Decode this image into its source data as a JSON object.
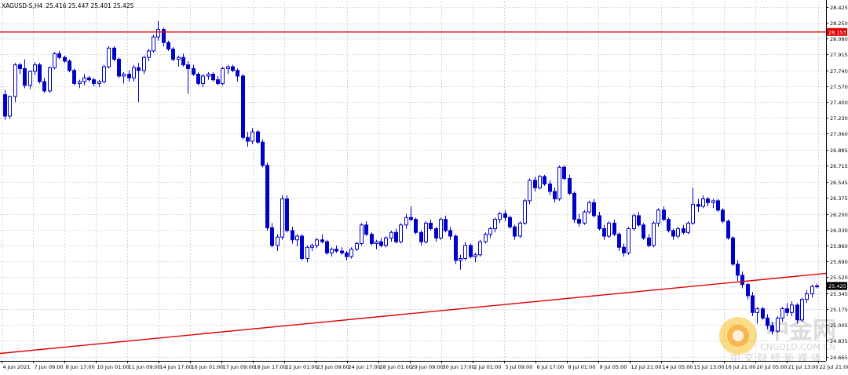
{
  "header": {
    "symbol": "XAGUSD-S,H4",
    "ohlc": "25.416 25.447 25.401 25.425"
  },
  "watermark": {
    "brand": "中金网",
    "url": "CNGOLD.COM.CN",
    "tagline": "中 文 财 经 新 媒 体"
  },
  "colors": {
    "background": "#ffffff",
    "grid": "#b4b4b4",
    "candle": "#0000c8",
    "resistance_line": "#e00000",
    "trend_line": "#e00000",
    "price_tag_red": "#e00000",
    "price_tag_dark": "#000000"
  },
  "chart_data": {
    "type": "candlestick",
    "timeframe": "H4",
    "ylim": [
      24.62,
      28.48
    ],
    "grid": true,
    "y_ticks": [
      "28.425",
      "28.250",
      "28.080",
      "27.915",
      "27.740",
      "27.570",
      "27.400",
      "27.230",
      "27.060",
      "26.885",
      "26.715",
      "26.545",
      "26.375",
      "26.200",
      "26.030",
      "25.860",
      "25.690",
      "25.520",
      "25.345",
      "25.175",
      "25.005",
      "24.835",
      "24.665"
    ],
    "x_ticks": [
      "4 Jun 2021",
      "7 Jun 09:00",
      "8 Jun 17:00",
      "10 Jun 01:00",
      "11 Jun 09:00",
      "14 Jun 17:00",
      "16 Jun 01:00",
      "17 Jun 09:00",
      "18 Jun 17:00",
      "22 Jun 01:00",
      "23 Jun 09:00",
      "24 Jun 17:00",
      "28 Jun 01:00",
      "29 Jun 09:00",
      "30 Jun 17:00",
      "2 Jul 01:00",
      "5 Jul 09:00",
      "6 Jul 17:00",
      "8 Jul 01:00",
      "9 Jul 05:00",
      "12 Jul 21:00",
      "14 Jul 05:00",
      "15 Jul 13:00",
      "16 Jul 21:00",
      "20 Jul 05:00",
      "21 Jul 13:00",
      "22 Jul 21:00"
    ],
    "resistance_level": 28.153,
    "trend_line": {
      "from": 24.7,
      "to": 25.56
    },
    "current_price": 25.425,
    "candles": [
      [
        27.48,
        27.53,
        27.21,
        27.25
      ],
      [
        27.25,
        27.47,
        27.22,
        27.46
      ],
      [
        27.46,
        27.82,
        27.4,
        27.8
      ],
      [
        27.8,
        27.82,
        27.7,
        27.76
      ],
      [
        27.76,
        27.86,
        27.55,
        27.58
      ],
      [
        27.58,
        27.74,
        27.54,
        27.73
      ],
      [
        27.73,
        27.83,
        27.69,
        27.8
      ],
      [
        27.8,
        27.82,
        27.6,
        27.62
      ],
      [
        27.62,
        27.66,
        27.5,
        27.52
      ],
      [
        27.52,
        27.78,
        27.5,
        27.77
      ],
      [
        27.77,
        27.94,
        27.75,
        27.92
      ],
      [
        27.92,
        27.95,
        27.86,
        27.88
      ],
      [
        27.88,
        27.9,
        27.82,
        27.84
      ],
      [
        27.84,
        27.86,
        27.72,
        27.74
      ],
      [
        27.74,
        27.76,
        27.58,
        27.6
      ],
      [
        27.6,
        27.64,
        27.55,
        27.62
      ],
      [
        27.62,
        27.7,
        27.58,
        27.66
      ],
      [
        27.66,
        27.68,
        27.62,
        27.64
      ],
      [
        27.64,
        27.66,
        27.57,
        27.6
      ],
      [
        27.6,
        27.64,
        27.56,
        27.62
      ],
      [
        27.62,
        27.8,
        27.6,
        27.78
      ],
      [
        27.78,
        28.0,
        27.76,
        27.98
      ],
      [
        27.98,
        28.0,
        27.84,
        27.86
      ],
      [
        27.86,
        27.88,
        27.66,
        27.68
      ],
      [
        27.68,
        27.72,
        27.6,
        27.7
      ],
      [
        27.7,
        27.74,
        27.62,
        27.66
      ],
      [
        27.66,
        27.8,
        27.62,
        27.77
      ],
      [
        27.77,
        27.82,
        27.4,
        27.74
      ],
      [
        27.74,
        27.9,
        27.7,
        27.88
      ],
      [
        27.88,
        27.97,
        27.84,
        27.95
      ],
      [
        27.95,
        28.12,
        27.93,
        28.1
      ],
      [
        28.1,
        28.27,
        28.06,
        28.18
      ],
      [
        28.18,
        28.2,
        28.0,
        28.04
      ],
      [
        28.04,
        28.06,
        27.95,
        27.97
      ],
      [
        27.97,
        27.99,
        27.84,
        27.86
      ],
      [
        27.86,
        27.9,
        27.78,
        27.88
      ],
      [
        27.88,
        27.92,
        27.78,
        27.8
      ],
      [
        27.8,
        27.84,
        27.49,
        27.76
      ],
      [
        27.76,
        27.8,
        27.68,
        27.7
      ],
      [
        27.7,
        27.72,
        27.58,
        27.6
      ],
      [
        27.6,
        27.7,
        27.56,
        27.68
      ],
      [
        27.68,
        27.72,
        27.64,
        27.7
      ],
      [
        27.7,
        27.72,
        27.62,
        27.64
      ],
      [
        27.64,
        27.68,
        27.58,
        27.6
      ],
      [
        27.6,
        27.78,
        27.58,
        27.76
      ],
      [
        27.76,
        27.8,
        27.7,
        27.78
      ],
      [
        27.78,
        27.8,
        27.72,
        27.74
      ],
      [
        27.74,
        27.76,
        27.62,
        27.68
      ],
      [
        27.68,
        27.7,
        27.0,
        27.02
      ],
      [
        27.02,
        27.08,
        26.92,
        26.98
      ],
      [
        26.98,
        27.12,
        26.95,
        27.08
      ],
      [
        27.08,
        27.1,
        26.95,
        26.97
      ],
      [
        26.97,
        27.0,
        26.7,
        26.72
      ],
      [
        26.72,
        26.75,
        26.02,
        26.05
      ],
      [
        26.05,
        26.1,
        25.84,
        25.86
      ],
      [
        25.86,
        25.98,
        25.8,
        25.95
      ],
      [
        25.95,
        26.4,
        25.92,
        26.36
      ],
      [
        26.36,
        26.4,
        26.0,
        26.02
      ],
      [
        26.02,
        26.06,
        25.88,
        25.92
      ],
      [
        25.92,
        25.98,
        25.85,
        25.96
      ],
      [
        25.96,
        25.98,
        25.7,
        25.72
      ],
      [
        25.72,
        25.86,
        25.68,
        25.84
      ],
      [
        25.84,
        25.88,
        25.8,
        25.86
      ],
      [
        25.86,
        25.94,
        25.83,
        25.92
      ],
      [
        25.92,
        25.98,
        25.88,
        25.9
      ],
      [
        25.9,
        25.92,
        25.76,
        25.78
      ],
      [
        25.78,
        25.84,
        25.74,
        25.82
      ],
      [
        25.82,
        25.86,
        25.78,
        25.8
      ],
      [
        25.8,
        25.84,
        25.76,
        25.78
      ],
      [
        25.78,
        25.8,
        25.7,
        25.74
      ],
      [
        25.74,
        25.84,
        25.72,
        25.82
      ],
      [
        25.82,
        25.9,
        25.8,
        25.88
      ],
      [
        25.88,
        26.1,
        25.86,
        26.08
      ],
      [
        26.08,
        26.12,
        25.96,
        25.98
      ],
      [
        25.98,
        26.0,
        25.86,
        25.88
      ],
      [
        25.88,
        25.92,
        25.82,
        25.9
      ],
      [
        25.9,
        25.94,
        25.84,
        25.86
      ],
      [
        25.86,
        25.96,
        25.84,
        25.94
      ],
      [
        25.94,
        26.02,
        25.9,
        26.0
      ],
      [
        26.0,
        26.04,
        25.88,
        25.9
      ],
      [
        25.9,
        26.1,
        25.88,
        26.08
      ],
      [
        26.08,
        26.2,
        26.04,
        26.16
      ],
      [
        26.16,
        26.28,
        26.12,
        26.14
      ],
      [
        26.14,
        26.16,
        25.98,
        26.0
      ],
      [
        26.0,
        26.02,
        25.86,
        25.9
      ],
      [
        25.9,
        26.12,
        25.88,
        26.1
      ],
      [
        26.1,
        26.14,
        26.02,
        26.04
      ],
      [
        26.04,
        26.06,
        25.9,
        25.94
      ],
      [
        25.94,
        26.16,
        25.92,
        26.14
      ],
      [
        26.14,
        26.18,
        26.0,
        26.02
      ],
      [
        26.02,
        26.06,
        25.92,
        25.96
      ],
      [
        25.96,
        25.98,
        25.66,
        25.7
      ],
      [
        25.7,
        25.76,
        25.6,
        25.72
      ],
      [
        25.72,
        25.9,
        25.7,
        25.86
      ],
      [
        25.86,
        25.88,
        25.72,
        25.74
      ],
      [
        25.74,
        25.78,
        25.68,
        25.76
      ],
      [
        25.76,
        25.92,
        25.74,
        25.9
      ],
      [
        25.9,
        26.0,
        25.88,
        25.98
      ],
      [
        25.98,
        26.06,
        25.94,
        26.04
      ],
      [
        26.04,
        26.16,
        26.0,
        26.14
      ],
      [
        26.14,
        26.22,
        26.1,
        26.2
      ],
      [
        26.2,
        26.24,
        26.12,
        26.16
      ],
      [
        26.16,
        26.18,
        26.04,
        26.06
      ],
      [
        26.06,
        26.08,
        25.92,
        25.96
      ],
      [
        25.96,
        26.12,
        25.94,
        26.1
      ],
      [
        26.1,
        26.36,
        26.08,
        26.34
      ],
      [
        26.34,
        26.58,
        26.3,
        26.56
      ],
      [
        26.56,
        26.6,
        26.44,
        26.48
      ],
      [
        26.48,
        26.62,
        26.46,
        26.6
      ],
      [
        26.6,
        26.62,
        26.5,
        26.52
      ],
      [
        26.52,
        26.56,
        26.4,
        26.44
      ],
      [
        26.44,
        26.48,
        26.32,
        26.36
      ],
      [
        26.36,
        26.72,
        26.34,
        26.7
      ],
      [
        26.7,
        26.72,
        26.56,
        26.58
      ],
      [
        26.58,
        26.62,
        26.4,
        26.42
      ],
      [
        26.42,
        26.44,
        26.1,
        26.14
      ],
      [
        26.14,
        26.2,
        26.06,
        26.1
      ],
      [
        26.1,
        26.24,
        26.08,
        26.22
      ],
      [
        26.22,
        26.34,
        26.2,
        26.32
      ],
      [
        26.32,
        26.36,
        26.16,
        26.18
      ],
      [
        26.18,
        26.22,
        26.02,
        26.04
      ],
      [
        26.04,
        26.08,
        25.92,
        25.96
      ],
      [
        25.96,
        26.12,
        25.94,
        26.1
      ],
      [
        26.1,
        26.14,
        25.96,
        25.98
      ],
      [
        25.98,
        26.0,
        25.8,
        25.84
      ],
      [
        25.84,
        25.88,
        25.74,
        25.78
      ],
      [
        25.78,
        26.06,
        25.76,
        26.04
      ],
      [
        26.04,
        26.2,
        26.02,
        26.18
      ],
      [
        26.18,
        26.22,
        26.06,
        26.08
      ],
      [
        26.08,
        26.1,
        25.92,
        25.94
      ],
      [
        25.94,
        25.98,
        25.84,
        25.86
      ],
      [
        25.86,
        26.12,
        25.84,
        26.1
      ],
      [
        26.1,
        26.26,
        26.06,
        26.24
      ],
      [
        26.24,
        26.28,
        26.12,
        26.14
      ],
      [
        26.14,
        26.16,
        26.0,
        26.02
      ],
      [
        26.02,
        26.04,
        25.92,
        25.96
      ],
      [
        25.96,
        26.06,
        25.94,
        26.04
      ],
      [
        26.04,
        26.08,
        25.98,
        26.0
      ],
      [
        26.0,
        26.12,
        25.98,
        26.1
      ],
      [
        26.1,
        26.48,
        26.08,
        26.3
      ],
      [
        26.3,
        26.36,
        26.22,
        26.28
      ],
      [
        26.28,
        26.4,
        26.26,
        26.36
      ],
      [
        26.36,
        26.38,
        26.28,
        26.32
      ],
      [
        26.32,
        26.36,
        26.26,
        26.34
      ],
      [
        26.34,
        26.36,
        26.22,
        26.24
      ],
      [
        26.24,
        26.26,
        26.1,
        26.12
      ],
      [
        26.12,
        26.14,
        25.92,
        25.94
      ],
      [
        25.94,
        25.96,
        25.64,
        25.66
      ],
      [
        25.66,
        25.7,
        25.48,
        25.54
      ],
      [
        25.54,
        25.58,
        25.4,
        25.44
      ],
      [
        25.44,
        25.46,
        25.28,
        25.32
      ],
      [
        25.32,
        25.36,
        25.1,
        25.14
      ],
      [
        25.14,
        25.2,
        25.02,
        25.18
      ],
      [
        25.18,
        25.2,
        25.06,
        25.08
      ],
      [
        25.08,
        25.12,
        24.96,
        25.0
      ],
      [
        25.0,
        25.04,
        24.9,
        24.94
      ],
      [
        24.94,
        25.1,
        24.92,
        25.08
      ],
      [
        25.08,
        25.2,
        25.04,
        25.18
      ],
      [
        25.18,
        25.24,
        25.1,
        25.14
      ],
      [
        25.14,
        25.26,
        25.1,
        25.22
      ],
      [
        25.22,
        25.24,
        25.02,
        25.06
      ],
      [
        25.06,
        25.3,
        25.04,
        25.28
      ],
      [
        25.28,
        25.38,
        25.24,
        25.34
      ],
      [
        25.34,
        25.44,
        25.3,
        25.42
      ],
      [
        25.42,
        25.45,
        25.4,
        25.425
      ]
    ]
  }
}
